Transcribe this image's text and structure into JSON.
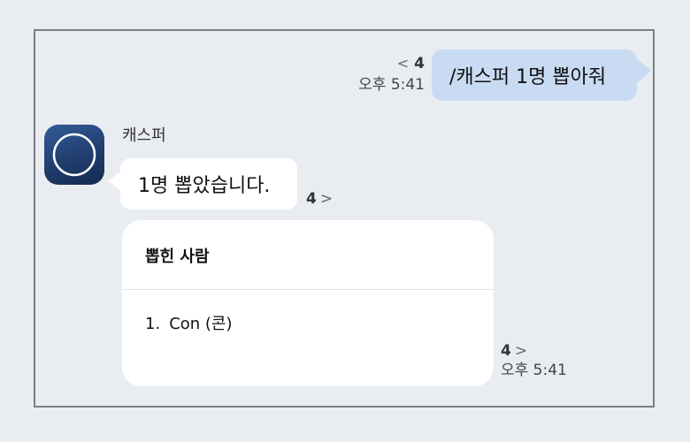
{
  "outgoing": {
    "text": "/캐스퍼 1명 뽑아줘",
    "unread_chevron": "<",
    "unread_count": "4",
    "time": "오후 5:41"
  },
  "incoming": {
    "sender": "캐스퍼",
    "avatar_icon": "circle-logo-icon",
    "message": "1명 뽑았습니다.",
    "unread_count": "4",
    "unread_chevron": ">"
  },
  "card": {
    "title": "뽑힌 사람",
    "items": [
      {
        "number": "1.",
        "label": "Con (콘)"
      }
    ],
    "unread_count": "4",
    "unread_chevron": ">",
    "time": "오후 5:41"
  },
  "colors": {
    "background": "#e9ecf0",
    "outgoing_bubble": "#c9dbf2",
    "incoming_bubble": "#ffffff",
    "avatar": "#2a4a80"
  }
}
